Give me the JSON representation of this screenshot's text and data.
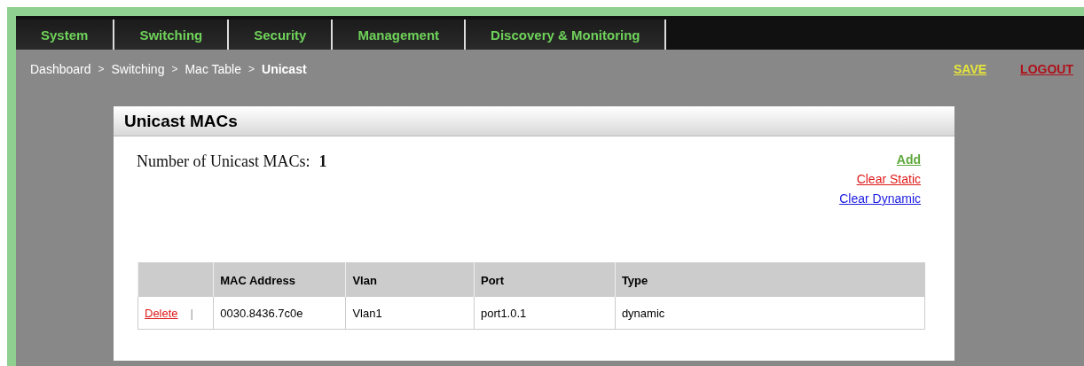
{
  "nav": {
    "tabs": [
      "System",
      "Switching",
      "Security",
      "Management",
      "Discovery & Monitoring"
    ]
  },
  "breadcrumb": {
    "separator": ">",
    "items": [
      "Dashboard",
      "Switching",
      "Mac Table",
      "Unicast"
    ]
  },
  "actions": {
    "save": "SAVE",
    "logout": "LOGOUT"
  },
  "panel": {
    "title": "Unicast MACs",
    "count_label": "Number of Unicast MACs:",
    "count": "1",
    "links": [
      {
        "label": "Add",
        "color": "#5fa83c"
      },
      {
        "label": "Clear Static",
        "color": "#e01b1b"
      },
      {
        "label": "Clear Dynamic",
        "color": "#1a1ae0"
      }
    ],
    "table": {
      "columns": [
        "MAC Address",
        "Vlan",
        "Port",
        "Type"
      ],
      "rows": [
        {
          "action": "Delete",
          "divider": "|",
          "cells": [
            "0030.8436.7c0e",
            "Vlan1",
            "port1.0.1",
            "dynamic"
          ]
        }
      ]
    }
  }
}
